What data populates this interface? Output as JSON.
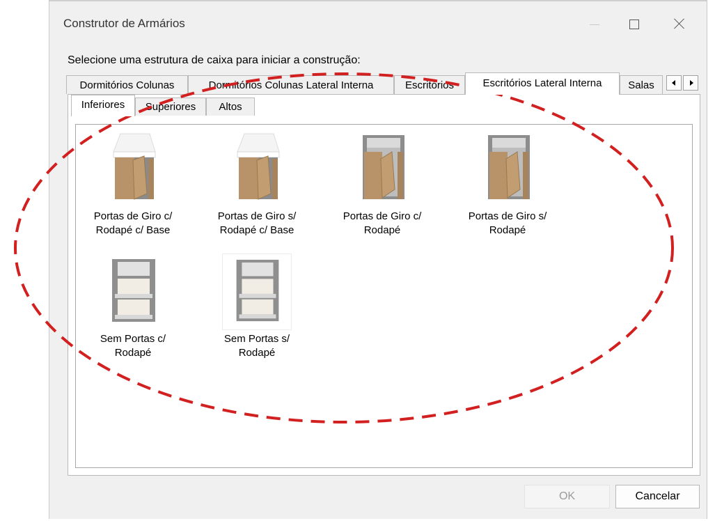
{
  "window": {
    "title": "Construtor de Armários",
    "minimize_icon": "minimize-icon",
    "maximize_icon": "maximize-icon",
    "close_icon": "close-icon"
  },
  "instruction": "Selecione uma estrutura de caixa para iniciar a construção:",
  "tabs": [
    {
      "label": "Dormitórios Colunas",
      "active": false
    },
    {
      "label": "Dormitórios Colunas Lateral Interna",
      "active": false
    },
    {
      "label": "Escritórios",
      "active": false
    },
    {
      "label": "Escritórios Lateral Interna",
      "active": true
    },
    {
      "label": "Salas",
      "active": false
    }
  ],
  "tab_scroll_icons": [
    "arrow-left-icon",
    "arrow-right-icon"
  ],
  "subtabs": [
    {
      "label": "Inferiores",
      "active": true
    },
    {
      "label": "Superiores",
      "active": false
    },
    {
      "label": "Altos",
      "active": false
    }
  ],
  "items": [
    {
      "line1": "Portas de Giro c/",
      "line2": "Rodapé c/ Base",
      "icon": "cabinet-doors-top-icon"
    },
    {
      "line1": "Portas de Giro s/",
      "line2": "Rodapé c/ Base",
      "icon": "cabinet-doors-top-icon"
    },
    {
      "line1": "Portas de Giro c/",
      "line2": "Rodapé",
      "icon": "cabinet-doors-open-icon"
    },
    {
      "line1": "Portas de Giro s/",
      "line2": "Rodapé",
      "icon": "cabinet-doors-open-icon"
    },
    {
      "line1": "Sem Portas c/",
      "line2": "Rodapé",
      "icon": "cabinet-shelves-icon"
    },
    {
      "line1": "Sem Portas s/",
      "line2": "Rodapé",
      "icon": "cabinet-shelves-icon"
    }
  ],
  "buttons": {
    "ok": "OK",
    "cancel": "Cancelar"
  },
  "colors": {
    "annotation": "#d21f1f",
    "wood": "#b89268",
    "window_bg": "#f0f0f0"
  }
}
